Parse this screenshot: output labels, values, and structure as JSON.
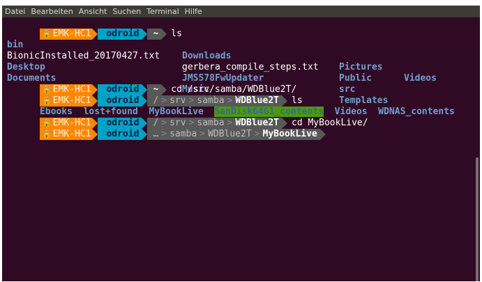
{
  "menu": [
    "Datei",
    "Bearbeiten",
    "Ansicht",
    "Suchen",
    "Terminal",
    "Hilfe"
  ],
  "prompt": {
    "lock_icon": "lock-icon",
    "host": "EMK-HC1",
    "user": "odroid",
    "home": "~"
  },
  "colors": {
    "background": "#300a24",
    "host": "#ff8700",
    "user": "#00a1c6",
    "path": "#585858",
    "dir": "#729fcf",
    "highlight": "#4e9a06"
  },
  "lines": {
    "l1": {
      "cmd": "ls"
    },
    "ls_home": [
      {
        "col1": "bin",
        "col2": "Downloads",
        "col3": "Pictures",
        "col4": "Videos"
      },
      {
        "col1": "BionicInstalled_20170427.txt",
        "col2": "gerbera_compile_steps.txt",
        "col3": "Public",
        "col4": ""
      },
      {
        "col1": "Desktop",
        "col2": "JMS578FwUpdater",
        "col3": "src",
        "col4": ""
      },
      {
        "col1": "Documents",
        "col2": "Music",
        "col3": "Templates",
        "col4": ""
      }
    ],
    "l6": {
      "cmd": "cd /srv/samba/WDBlue2T/"
    },
    "l7": {
      "p1": "/",
      "p2": "srv",
      "p3": "samba",
      "p4": "WDBlue2T",
      "cmd": "ls"
    },
    "ls_wd": [
      "Ebooks",
      "lost+found",
      "MyBookLive",
      "SanDisk64G1_contents",
      "Videos",
      "WDNAS_contents"
    ],
    "l9": {
      "p1": "/",
      "p2": "srv",
      "p3": "samba",
      "p4": "WDBlue2T",
      "cmd": "cd MyBookLive/"
    },
    "l10": {
      "p1": "…",
      "p2": "samba",
      "p3": "WDBlue2T",
      "p4": "MyBookLive"
    }
  }
}
